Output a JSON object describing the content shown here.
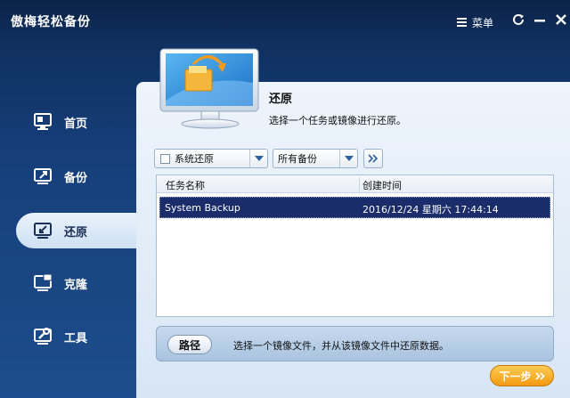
{
  "app": {
    "title": "傲梅轻松备份"
  },
  "titlebar": {
    "menu_label": "菜单",
    "menu_icon": "hamburger-icon",
    "refresh_icon": "refresh-icon",
    "minimize_icon": "minimize-icon",
    "close_icon": "close-icon"
  },
  "sidebar": {
    "items": [
      {
        "label": "首页",
        "icon": "home-monitor-icon",
        "active": false
      },
      {
        "label": "备份",
        "icon": "backup-monitor-icon",
        "active": false
      },
      {
        "label": "还原",
        "icon": "restore-monitor-icon",
        "active": true
      },
      {
        "label": "克隆",
        "icon": "clone-monitor-icon",
        "active": false
      },
      {
        "label": "工具",
        "icon": "tools-monitor-icon",
        "active": false
      }
    ]
  },
  "main": {
    "title": "还原",
    "description": "选择一个任务或镜像进行还原。",
    "filter": {
      "system_restore_label": "系统还原",
      "system_restore_checked": false,
      "backup_filter_value": "所有备份"
    },
    "table": {
      "columns": [
        "任务名称",
        "创建时间"
      ],
      "rows": [
        {
          "name": "System Backup",
          "time": "2016/12/24 星期六 17:44:14",
          "selected": true
        }
      ]
    },
    "path": {
      "button_label": "路径",
      "description": "选择一个镜像文件，并从该镜像文件中还原数据。"
    },
    "next_button_label": "下一步"
  },
  "colors": {
    "accent_orange": "#f39a12",
    "selection_navy": "#1b2c6b",
    "window_blue": "#163f7a"
  }
}
